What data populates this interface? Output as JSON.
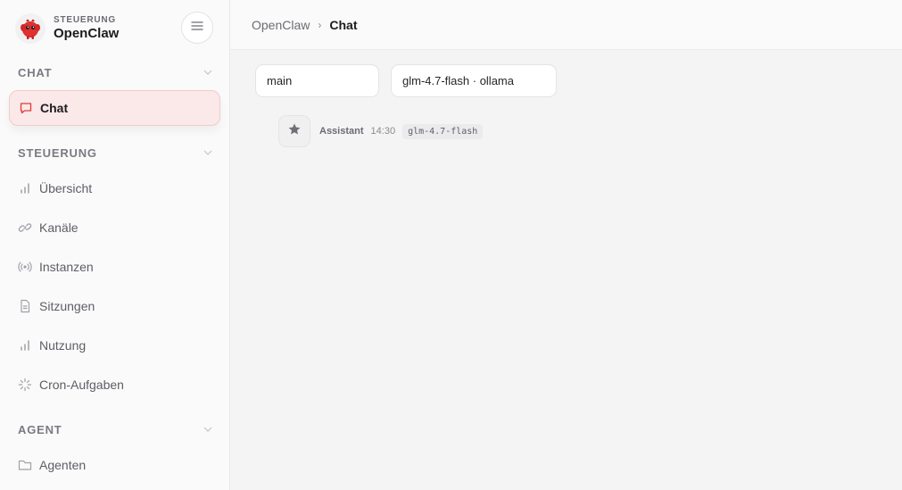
{
  "brand": {
    "subtitle": "STEUERUNG",
    "title": "OpenClaw"
  },
  "sidebar": {
    "sections": [
      {
        "label": "CHAT",
        "items": [
          {
            "label": "Chat",
            "icon": "message-icon",
            "active": true
          }
        ]
      },
      {
        "label": "STEUERUNG",
        "items": [
          {
            "label": "Übersicht",
            "icon": "bar-chart-icon"
          },
          {
            "label": "Kanäle",
            "icon": "link-icon"
          },
          {
            "label": "Instanzen",
            "icon": "radio-icon"
          },
          {
            "label": "Sitzungen",
            "icon": "file-icon"
          },
          {
            "label": "Nutzung",
            "icon": "bar-chart-icon"
          },
          {
            "label": "Cron-Aufgaben",
            "icon": "loader-icon"
          }
        ]
      },
      {
        "label": "AGENT",
        "items": [
          {
            "label": "Agenten",
            "icon": "folder-icon"
          }
        ]
      }
    ]
  },
  "breadcrumb": {
    "root": "OpenClaw",
    "separator": "›",
    "current": "Chat"
  },
  "session_select": {
    "value": "main"
  },
  "model_select": {
    "value": "glm-4.7-flash · ollama"
  },
  "message": {
    "sender": "Assistant",
    "time": "14:30",
    "model": "glm-4.7-flash",
    "avatar_icon": "star-icon"
  },
  "colors": {
    "accent": "#e03a3a",
    "active_bg": "#fbe8e8"
  }
}
